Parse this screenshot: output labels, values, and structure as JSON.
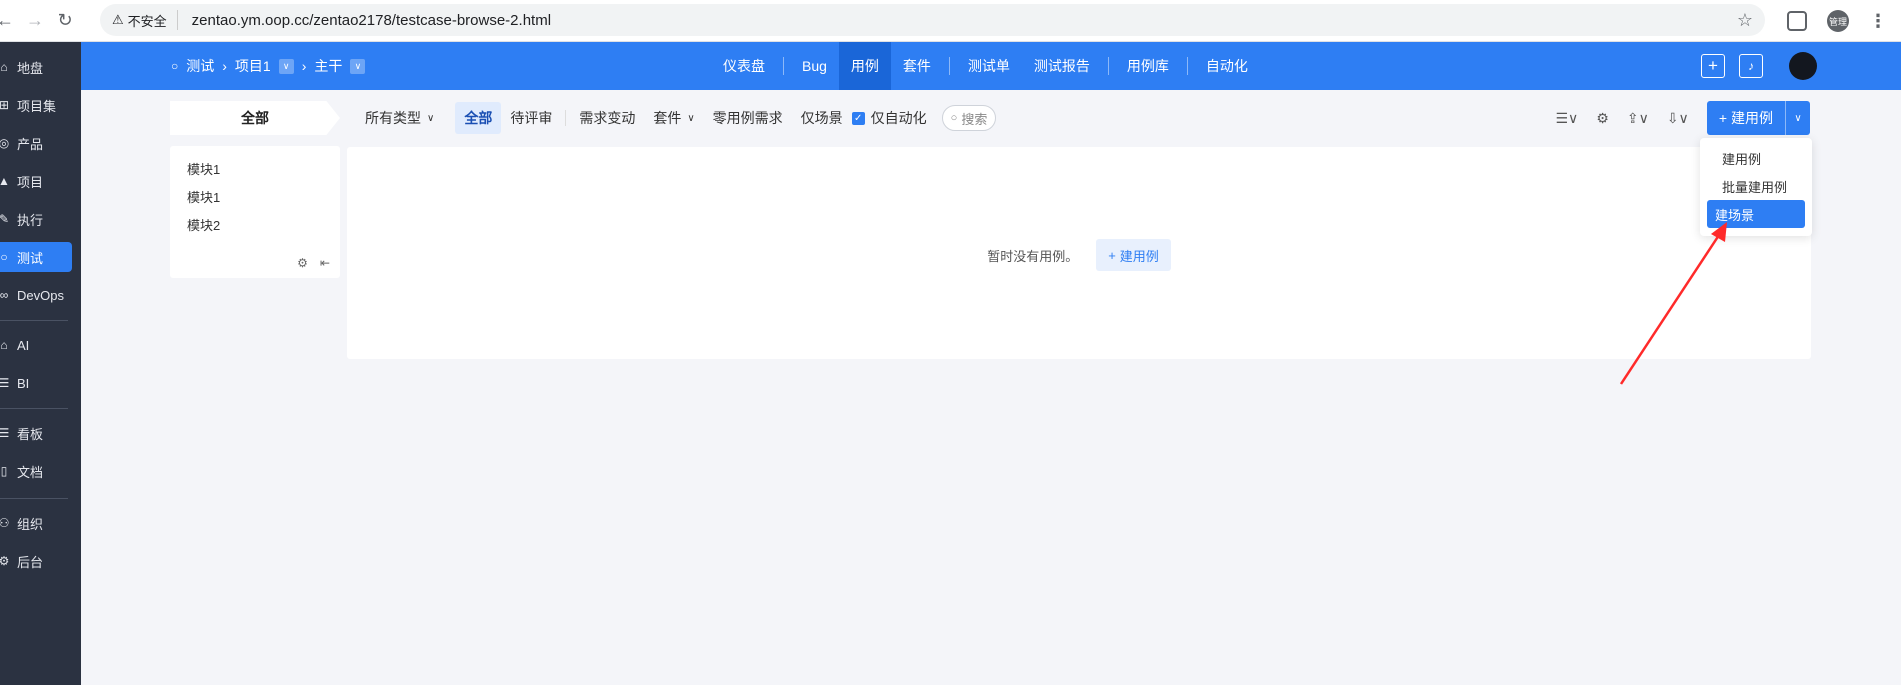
{
  "browser": {
    "security_label": "不安全",
    "url": "zentao.ym.oop.cc/zentao2178/testcase-browse-2.html",
    "profile_label": "管理"
  },
  "sidebar": {
    "items": [
      {
        "label": "地盘",
        "icon": "home-icon"
      },
      {
        "label": "项目集",
        "icon": "grid-icon"
      },
      {
        "label": "产品",
        "icon": "bulb-icon"
      },
      {
        "label": "项目",
        "icon": "rocket-icon"
      },
      {
        "label": "执行",
        "icon": "tools-icon"
      },
      {
        "label": "测试",
        "icon": "search-icon"
      },
      {
        "label": "DevOps",
        "icon": "infinity-icon"
      },
      {
        "label": "AI",
        "icon": "robot-icon"
      },
      {
        "label": "BI",
        "icon": "chart-icon"
      },
      {
        "label": "看板",
        "icon": "board-icon"
      },
      {
        "label": "文档",
        "icon": "doc-icon"
      },
      {
        "label": "组织",
        "icon": "people-icon"
      },
      {
        "label": "后台",
        "icon": "gear-icon"
      }
    ]
  },
  "appnav": {
    "crumb_test": "测试",
    "crumb_project": "项目1",
    "crumb_branch": "主干",
    "tabs": [
      "仪表盘",
      "Bug",
      "用例",
      "套件",
      "测试单",
      "测试报告",
      "用例库",
      "自动化"
    ]
  },
  "filterbar": {
    "all_module": "全部",
    "type_filter": "所有类型",
    "filters": [
      "全部",
      "待评审",
      "需求变动",
      "套件",
      "零用例需求",
      "仅场景"
    ],
    "auto_only": "仅自动化",
    "search_placeholder": "搜索",
    "create_label": "建用例"
  },
  "tree": {
    "items": [
      "模块1",
      "模块1",
      "模块2"
    ]
  },
  "content": {
    "empty_text": "暂时没有用例。",
    "empty_button": "建用例"
  },
  "dropdown": {
    "items": [
      "建用例",
      "批量建用例",
      "建场景"
    ]
  },
  "colors": {
    "primary": "#2e7ef3",
    "sidebar": "#2b3241",
    "annotation": "#ff2a2a"
  }
}
